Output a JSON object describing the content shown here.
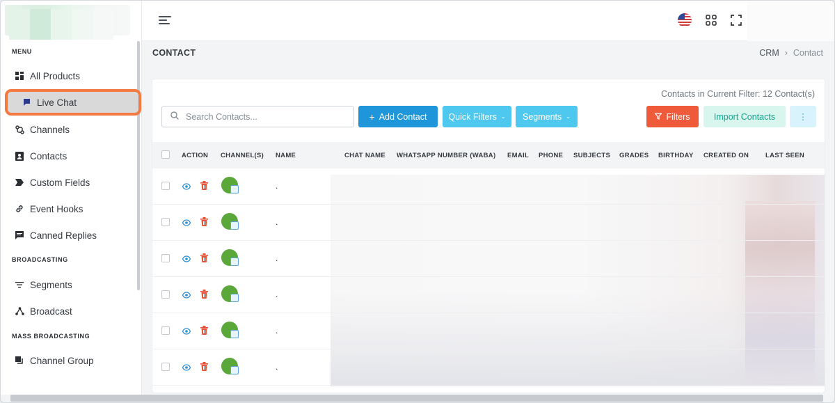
{
  "sidebar": {
    "sections": [
      {
        "title": "MENU"
      },
      {
        "title": "BROADCASTING"
      },
      {
        "title": "MASS BROADCASTING"
      }
    ],
    "items": [
      {
        "label": "All Products",
        "icon": "grid-icon"
      },
      {
        "label": "Live Chat",
        "icon": "chat-icon",
        "active": true
      },
      {
        "label": "Channels",
        "icon": "channels-icon"
      },
      {
        "label": "Contacts",
        "icon": "contact-card-icon"
      },
      {
        "label": "Custom Fields",
        "icon": "tag-icon"
      },
      {
        "label": "Event Hooks",
        "icon": "link-icon"
      },
      {
        "label": "Canned Replies",
        "icon": "message-square-icon"
      },
      {
        "label": "Segments",
        "icon": "filter-lines-icon"
      },
      {
        "label": "Broadcast",
        "icon": "broadcast-icon"
      },
      {
        "label": "Channel Group",
        "icon": "copy-icon"
      }
    ]
  },
  "topbar": {
    "icons": [
      "hamburger-icon",
      "us-flag-icon",
      "apps-grid-icon",
      "fullscreen-icon"
    ]
  },
  "page": {
    "title": "CONTACT",
    "breadcrumb": [
      "CRM",
      "Contact"
    ]
  },
  "toolbar": {
    "filter_count": "Contacts in Current Filter: 12 Contact(s)",
    "search_placeholder": "Search Contacts...",
    "add_contact": "Add Contact",
    "quick_filters": "Quick Filters",
    "segments": "Segments",
    "filters": "Filters",
    "import_contacts": "Import Contacts",
    "more": "⋮"
  },
  "table": {
    "columns": [
      "ACTION",
      "CHANNEL(S)",
      "NAME",
      "CHAT NAME",
      "WHATSAPP NUMBER (WABA)",
      "EMAIL",
      "PHONE",
      "SUBJECTS",
      "GRADES",
      "BIRTHDAY",
      "CREATED ON",
      "LAST SEEN"
    ],
    "rows": [
      {
        "name": "."
      },
      {
        "name": "."
      },
      {
        "name": "."
      },
      {
        "name": "."
      },
      {
        "name": "."
      },
      {
        "name": "."
      }
    ]
  },
  "colors": {
    "accent_blue": "#1f95da",
    "light_blue": "#4fc8f0",
    "danger": "#ee5a3a",
    "highlight": "#f47a44",
    "whatsapp_green": "#5aa83a"
  }
}
